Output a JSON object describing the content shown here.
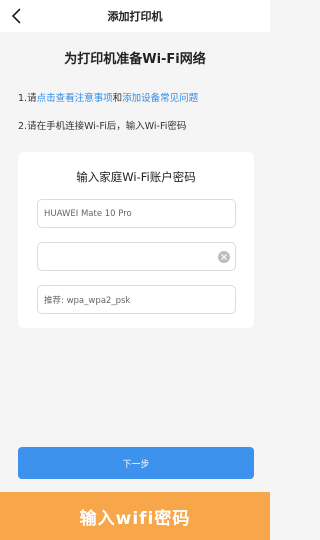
{
  "header": {
    "title": "添加打印机"
  },
  "main": {
    "title": "为打印机准备Wi-Fi网络",
    "step1": {
      "prefix": "1.请",
      "link1": "点击查看注意事项",
      "and": "和",
      "link2": "添加设备常见问题"
    },
    "step2": "2.请在手机连接Wi-Fi后，输入Wi-Fi密码"
  },
  "card": {
    "title": "输入家庭Wi-Fi账户密码",
    "ssid_value": "HUAWEI Mate 10 Pro",
    "password_value": "",
    "hint_value": "推荐: wpa_wpa2_psk"
  },
  "actions": {
    "next_label": "下一步"
  },
  "banner": {
    "text": "输入wifi密码"
  },
  "colors": {
    "accent": "#3d92ee",
    "link": "#2f8ce9",
    "banner": "#f7a64a"
  }
}
